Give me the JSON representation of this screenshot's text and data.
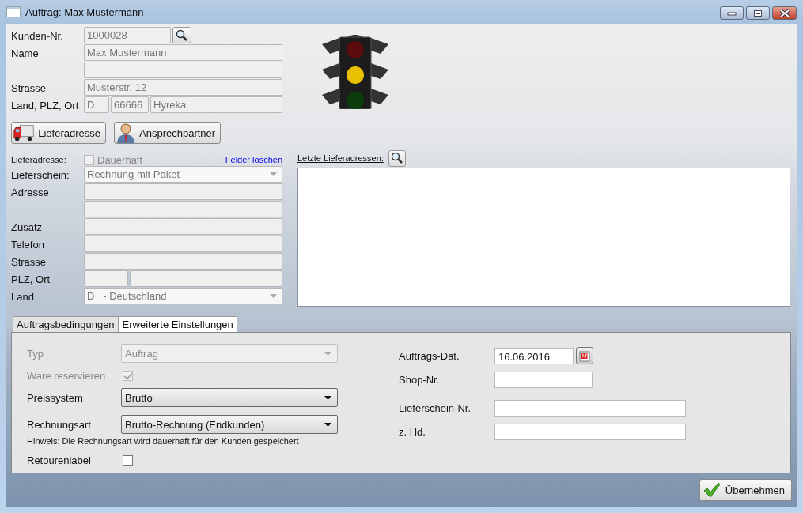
{
  "window": {
    "title": "Auftrag: Max Mustermann"
  },
  "customer": {
    "disabled": true,
    "rows": [
      {
        "label": "Kunden-Nr.",
        "kind": "search",
        "fields": [
          {
            "kind": "input",
            "value": "1000028"
          }
        ]
      },
      {
        "label": "Name",
        "kind": "text",
        "fields": [
          {
            "kind": "input",
            "value": "Max Mustermann"
          }
        ]
      },
      {
        "kind": "text",
        "fields": [
          {
            "kind": "input"
          }
        ]
      },
      {
        "label": "Strasse",
        "kind": "text",
        "fields": [
          {
            "kind": "input",
            "value": "Musterstr. 12"
          }
        ]
      },
      {
        "label": "Land, PLZ, Ort",
        "kind": "split",
        "fields": [
          {
            "kind": "input",
            "value": "D"
          },
          {
            "kind": "input",
            "value": "66666"
          },
          {
            "kind": "input",
            "value": "Hyreka"
          }
        ]
      }
    ]
  },
  "traffic_light": {
    "lamps": [
      {
        "color": "#5a0c0c"
      },
      {
        "color": "#e8c200"
      },
      {
        "color": "#0c3d0c"
      }
    ]
  },
  "actions": [
    {
      "label": "Lieferadresse",
      "kind": "truck"
    },
    {
      "label": "Ansprechpartner",
      "kind": "person"
    }
  ],
  "delivery": {
    "heading": "Lieferadresse:",
    "permanent": {
      "label": "Dauerhaft",
      "checked": false,
      "disabled": true
    },
    "clear_link": "Felder löschen",
    "disabled": true,
    "rows": [
      {
        "label": "Lieferschein:",
        "kind": "select",
        "fields": [
          {
            "kind": "input",
            "value": "Rechnung mit Paket"
          }
        ]
      },
      {
        "label": "Adresse",
        "kind": "text",
        "fields": [
          {
            "kind": "input"
          }
        ]
      },
      {
        "kind": "text",
        "fields": [
          {
            "kind": "input"
          }
        ]
      },
      {
        "label": "Zusatz",
        "kind": "text",
        "fields": [
          {
            "kind": "input"
          }
        ]
      },
      {
        "label": "Telefon",
        "kind": "text",
        "fields": [
          {
            "kind": "input"
          }
        ]
      },
      {
        "label": "Strasse",
        "kind": "text",
        "fields": [
          {
            "kind": "input"
          }
        ]
      },
      {
        "label": "PLZ, Ort",
        "kind": "split",
        "fields": [
          {
            "kind": "input"
          },
          {
            "kind": "input"
          }
        ]
      },
      {
        "label": "Land",
        "kind": "select",
        "fields": [
          {
            "kind": "input",
            "value": "D   - Deutschland"
          }
        ]
      }
    ]
  },
  "recent": {
    "heading": "Letzte Lieferadressen:"
  },
  "tabs": [
    {
      "label": "Auftragsbedingungen",
      "selected": false
    },
    {
      "label": "Erweiterte Einstellungen",
      "selected": true
    }
  ],
  "settings_left": [
    {
      "label": "Typ",
      "kind": "select",
      "value": "Auftrag",
      "disabled": true
    },
    {
      "label": "Ware reservieren",
      "kind": "checkbox",
      "checked": true,
      "disabled": true
    },
    {
      "label": "Preissystem",
      "kind": "select",
      "value": "Brutto",
      "disabled": false
    },
    {
      "label": "Rechnungsart",
      "kind": "select",
      "value": "Brutto-Rechnung (Endkunden)",
      "disabled": false,
      "hint": "Hinweis: Die Rechnungsart wird dauerhaft für den Kunden gespeichert"
    },
    {
      "label": "Retourenlabel",
      "kind": "checkbox",
      "checked": false,
      "disabled": false
    }
  ],
  "settings_right": [
    {
      "label": "Auftrags-Dat.",
      "kind": "date",
      "value": "16.06.2016"
    },
    {
      "label": "Shop-Nr.",
      "kind": "short"
    },
    {
      "label": "Lieferschein-Nr.",
      "kind": "long"
    },
    {
      "label": "z. Hd.",
      "kind": "long"
    }
  ],
  "submit": {
    "label": "Übernehmen"
  }
}
